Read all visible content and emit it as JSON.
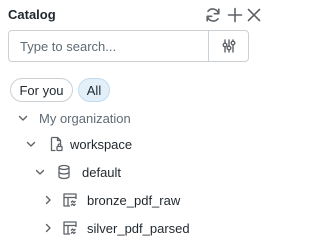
{
  "header": {
    "title": "Catalog",
    "refresh_icon": "refresh-icon",
    "add_icon": "plus-icon",
    "close_icon": "close-icon"
  },
  "search": {
    "placeholder": "Type to search...",
    "value": "",
    "filter_icon": "sliders-icon"
  },
  "chips": [
    {
      "label": "For you",
      "selected": false
    },
    {
      "label": "All",
      "selected": true
    }
  ],
  "tree": {
    "section_label": "My organization",
    "catalog": {
      "label": "workspace",
      "icon": "catalog-icon",
      "expanded": true
    },
    "schema": {
      "label": "default",
      "icon": "database-icon",
      "expanded": true
    },
    "tables": [
      {
        "label": "bronze_pdf_raw",
        "icon": "table-icon",
        "expanded": false
      },
      {
        "label": "silver_pdf_parsed",
        "icon": "table-icon",
        "expanded": false
      }
    ]
  },
  "colors": {
    "selected_chip_bg": "#e3eff9",
    "text": "#1f272d",
    "icon": "#5f6368",
    "border": "#cbd0d5"
  }
}
